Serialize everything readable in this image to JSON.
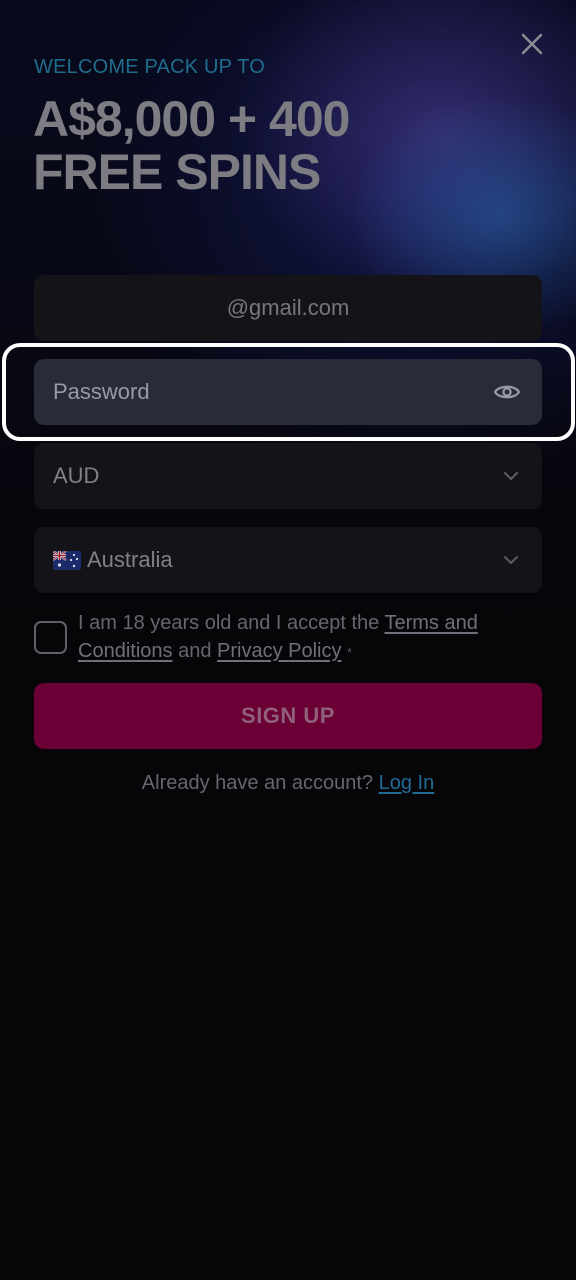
{
  "colors": {
    "background": "#060609",
    "eyebrow": "#1f6d8c",
    "headline": "#7c7c82",
    "field_bg": "#141418",
    "password_field_bg": "#2a2b38",
    "signup_bg": "#6a0035",
    "link": "#1f6a96",
    "highlight": "#ffffff"
  },
  "header": {
    "close_icon": "close-icon",
    "eyebrow": "WELCOME PACK UP TO",
    "headline_line1": "A$8,000 + 400",
    "headline_line2": "FREE SPINS"
  },
  "form": {
    "email": {
      "value": "@gmail.com"
    },
    "password": {
      "placeholder": "Password",
      "toggle_icon": "eye-icon"
    },
    "currency": {
      "value": "AUD",
      "icon": "chevron-down-icon"
    },
    "country": {
      "value": "Australia",
      "flag_icon": "australia-flag-icon",
      "icon": "chevron-down-icon"
    },
    "terms": {
      "text_before": "I am 18 years old and I accept the ",
      "terms_link": "Terms and Conditions",
      "text_between": " and ",
      "privacy_link": "Privacy Policy",
      "required_mark": "*"
    },
    "submit_label": "SIGN UP"
  },
  "footer": {
    "prompt": "Already have an account? ",
    "login_link": "Log In"
  }
}
